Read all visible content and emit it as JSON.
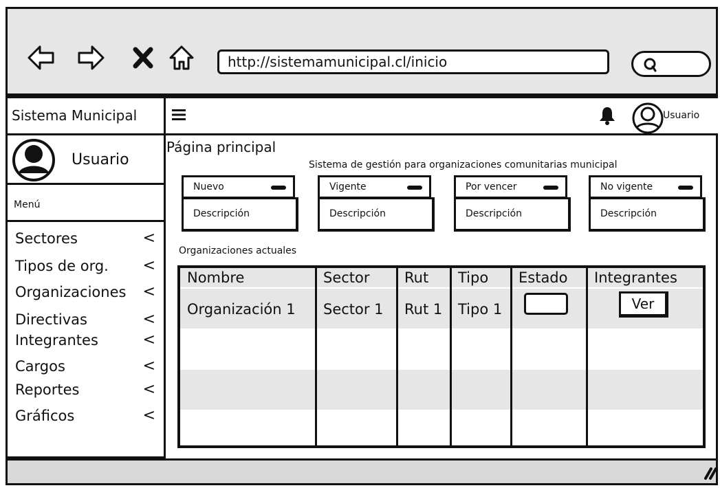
{
  "browser": {
    "url": "http://sistemamunicipal.cl/inicio",
    "nav_icons": [
      "back-arrow-icon",
      "forward-arrow-icon",
      "close-icon",
      "home-icon"
    ],
    "search_icon": "search-icon"
  },
  "app": {
    "brand": "Sistema Municipal",
    "top_user": "Usuario"
  },
  "sidebar": {
    "username": "Usuario",
    "menu_label": "Menú",
    "items": [
      {
        "label": "Sectores",
        "chevron": "<"
      },
      {
        "label": "Tipos de org.",
        "chevron": "<"
      },
      {
        "label": "Organizaciones",
        "chevron": "<"
      },
      {
        "label": "Directivas",
        "chevron": "<"
      },
      {
        "label": "Integrantes",
        "chevron": "<"
      },
      {
        "label": "Cargos",
        "chevron": "<"
      },
      {
        "label": "Reportes",
        "chevron": "<"
      },
      {
        "label": "Gráficos",
        "chevron": "<"
      }
    ]
  },
  "main": {
    "page_title": "Página principal",
    "subtitle": "Sistema de gestión para organizaciones comunitarias municipal",
    "cards": [
      {
        "title": "Nuevo",
        "description": "Descripción"
      },
      {
        "title": "Vigente",
        "description": "Descripción"
      },
      {
        "title": "Por vencer",
        "description": "Descripción"
      },
      {
        "title": "No vigente",
        "description": "Descripción"
      }
    ],
    "section_label": "Organizaciones actuales",
    "table": {
      "headers": [
        "Nombre",
        "Sector",
        "Rut",
        "Tipo",
        "Estado",
        "Integrantes"
      ],
      "rows": [
        {
          "nombre": "Organización 1",
          "sector": "Sector 1",
          "rut": "Rut 1",
          "tipo": "Tipo 1",
          "estado": "",
          "integrantes_button": "Ver"
        }
      ]
    }
  },
  "colors": {
    "chrome": "#e6e6e6",
    "stroke": "#111111",
    "footer": "#d9d9d9"
  }
}
